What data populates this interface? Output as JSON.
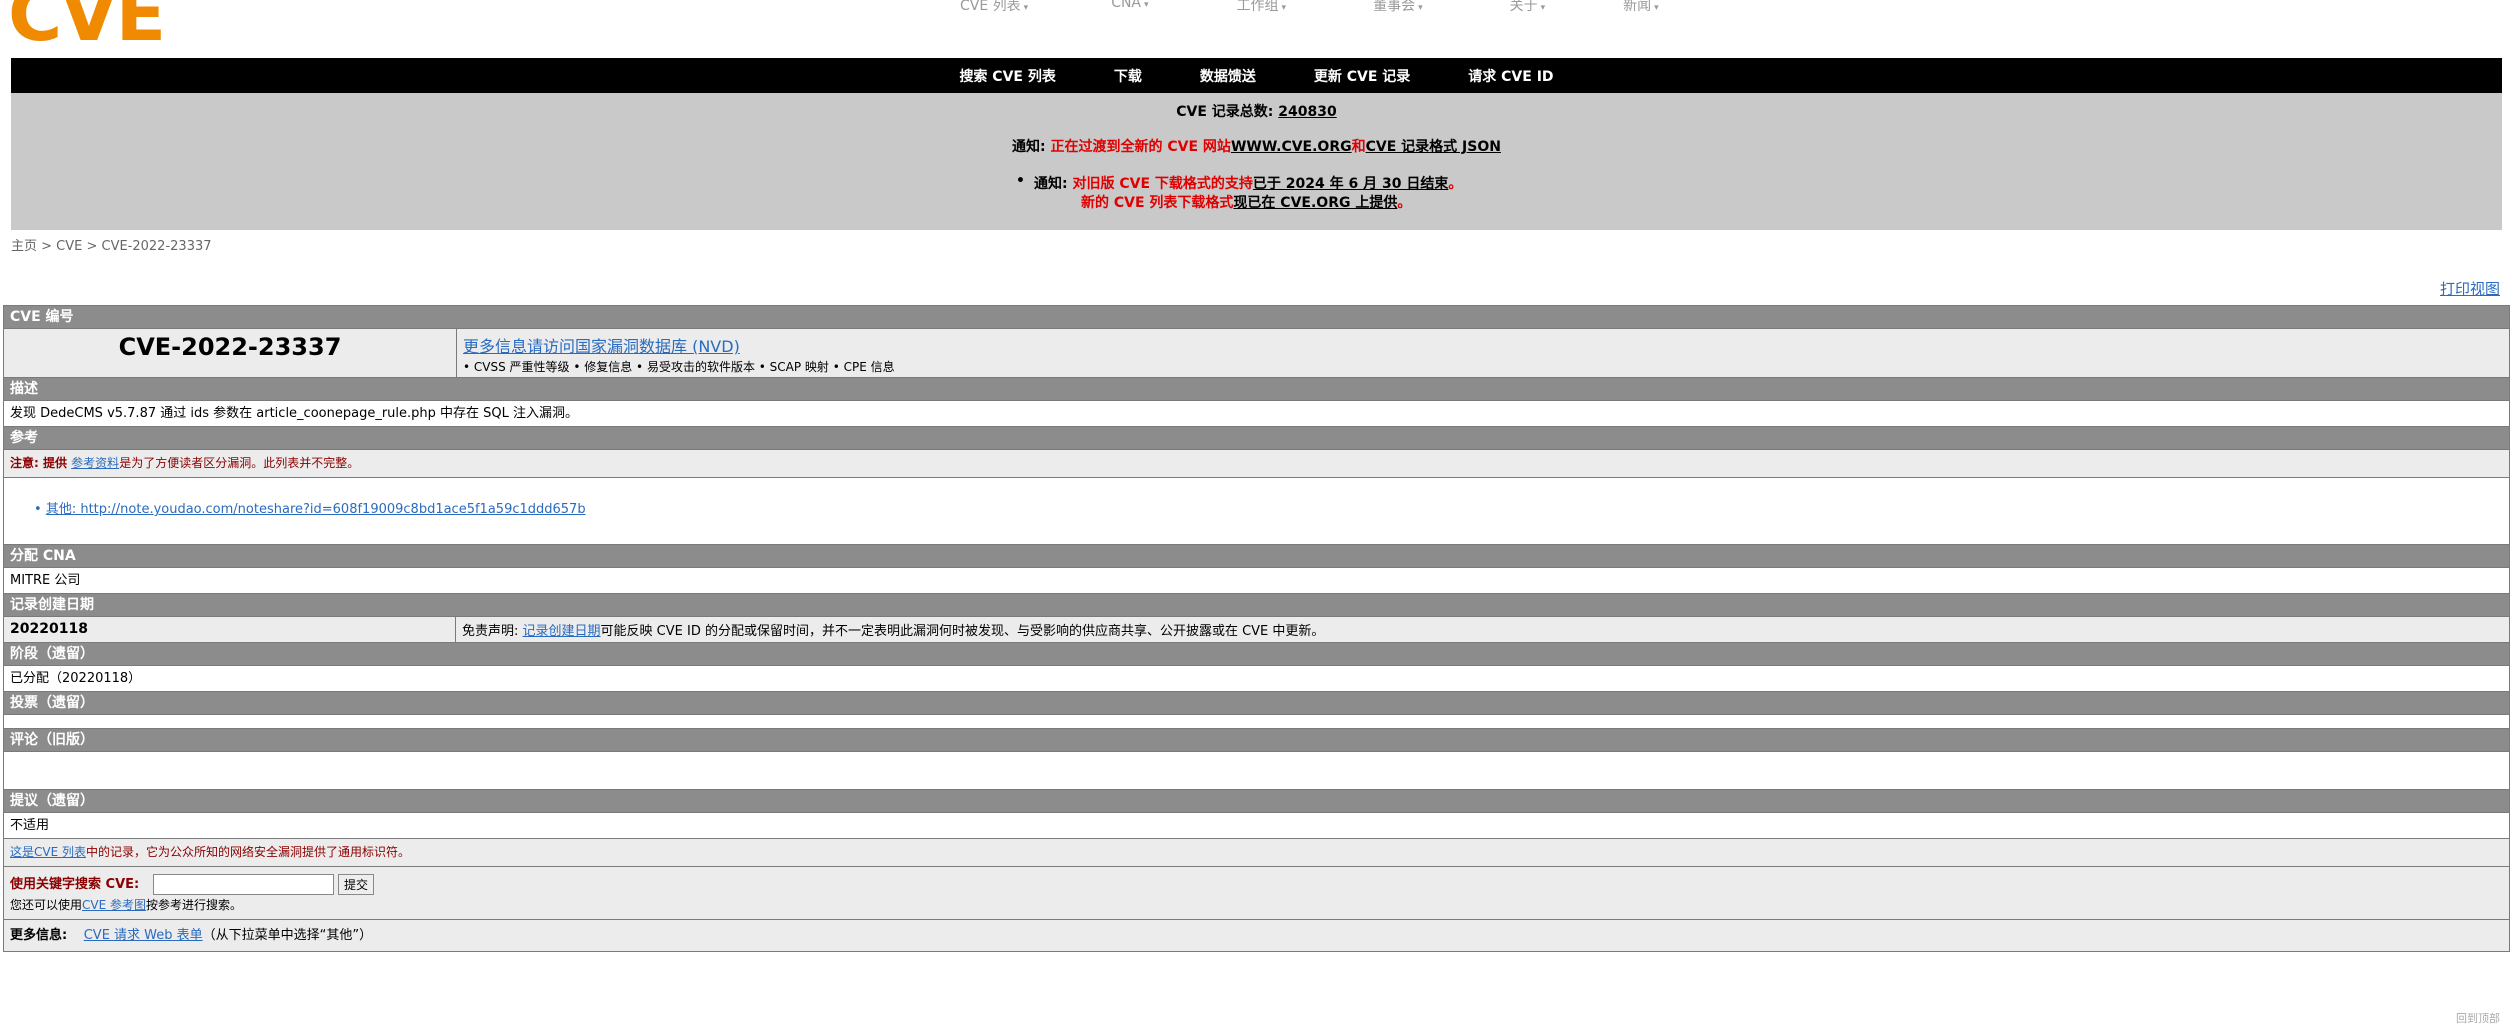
{
  "header": {
    "logo": "CVE",
    "logo_mark": "®",
    "nav": [
      {
        "label": "CVE 列表"
      },
      {
        "label": "CNA"
      },
      {
        "label": "工作组"
      },
      {
        "label": "董事会"
      },
      {
        "label": "关于"
      },
      {
        "label": "新闻"
      }
    ],
    "caret": "▾"
  },
  "blackbar": [
    "搜索 CVE 列表",
    "下载",
    "数据馈送",
    "更新 CVE 记录",
    "请求 CVE ID"
  ],
  "notice": {
    "total_label": "CVE 记录总数: ",
    "total_value": "240830",
    "n1_label": "通知: ",
    "n1_red": "正在过渡到全新的 CVE 网站",
    "n1_link1": "WWW.CVE.ORG",
    "n1_and": "和",
    "n1_link2": "CVE 记录格式 JSON",
    "bullet": "•",
    "n2_label": "通知: ",
    "n2_red1": "对旧版 CVE 下载格式的支持",
    "n2_link1": "已于 2024 年 6 月 30 日结束",
    "n2_dot1": "。",
    "n2_red2": "新的 CVE 列表下载格式",
    "n2_link2": "现已在 CVE.ORG 上提供",
    "n2_dot2": "。"
  },
  "breadcrumb": "主页 > CVE > CVE-2022-23337",
  "print_view": "打印视图",
  "record": {
    "sec_id": "CVE 编号",
    "cve_id": "CVE-2022-23337",
    "nvd_link": "更多信息请访问国家漏洞数据库 (NVD)",
    "nvd_sub": "• CVSS 严重性等级 • 修复信息 • 易受攻击的软件版本 • SCAP 映射 • CPE 信息",
    "sec_desc": "描述",
    "description": "发现 DedeCMS v5.7.87 通过 ids 参数在 article_coonepage_rule.php 中存在 SQL 注入漏洞。",
    "sec_ref": "参考",
    "ref_note_label": "注意: ",
    "ref_note_bold": "提供 ",
    "ref_note_link": "参考资料",
    "ref_note_rest": "是为了方便读者区分漏洞。此列表并不完整。",
    "ref_item": "其他: http://note.youdao.com/noteshare?id=608f19009c8bd1ace5f1a59c1ddd657b",
    "sec_cna": "分配 CNA",
    "cna": "MITRE 公司",
    "sec_date": "记录创建日期",
    "date": "20220118",
    "disclaimer_label": "免责声明: ",
    "disclaimer_link": "记录创建日期",
    "disclaimer_rest": "可能反映 CVE ID 的分配或保留时间，并不一定表明此漏洞何时被发现、与受影响的供应商共享、公开披露或在 CVE 中更新。",
    "sec_phase": "阶段（遗留）",
    "phase": "已分配（20220118）",
    "sec_votes": "投票（遗留）",
    "sec_comments": "评论（旧版）",
    "sec_proposed": "提议（遗留）",
    "proposed": "不适用",
    "record_note_link": "这是CVE 列表",
    "record_note_rest": "中的记录，它为公众所知的网络安全漏洞提供了通用标识符。",
    "search_label": "使用关键字搜索 CVE:",
    "search_value": "",
    "submit": "提交",
    "search_hint_pre": "您还可以使用",
    "search_hint_link": "CVE 参考图",
    "search_hint_post": "按参考进行搜索。",
    "more_label": "更多信息: ",
    "more_link": "CVE 请求 Web 表单",
    "more_rest": "（从下拉菜单中选择“其他”）"
  },
  "footer_right": "回到顶部"
}
